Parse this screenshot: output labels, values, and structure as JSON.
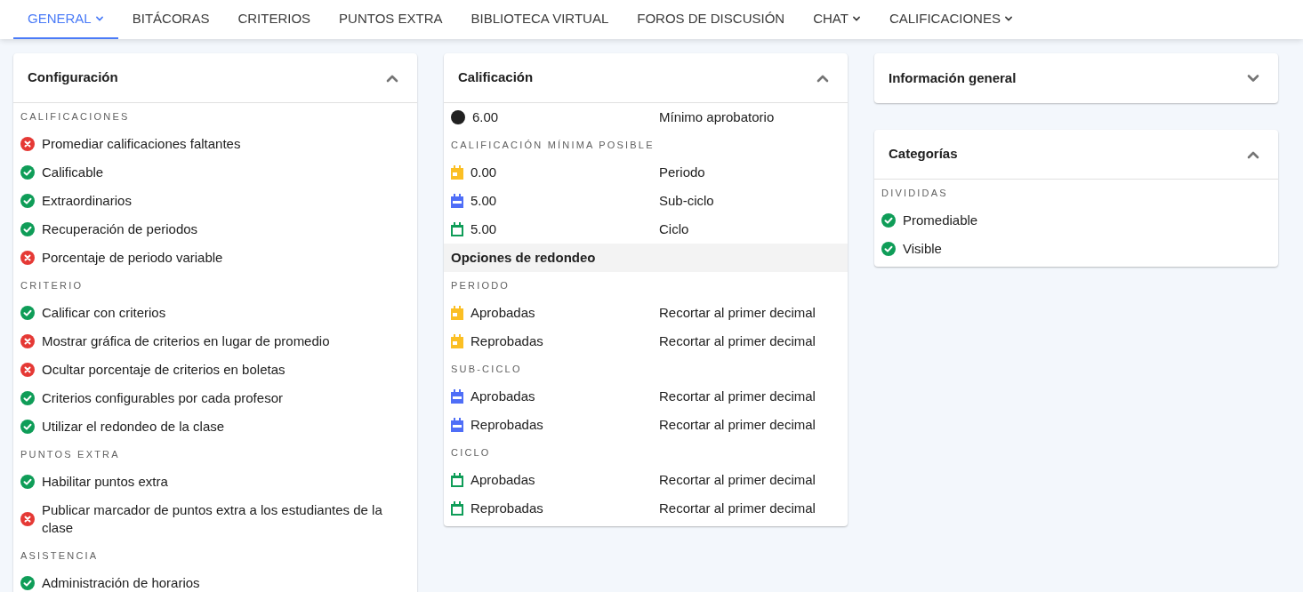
{
  "tabs": [
    {
      "label": "GENERAL",
      "selected": true,
      "dropdown": true
    },
    {
      "label": "BITÁCORAS",
      "selected": false,
      "dropdown": false
    },
    {
      "label": "CRITERIOS",
      "selected": false,
      "dropdown": false
    },
    {
      "label": "PUNTOS EXTRA",
      "selected": false,
      "dropdown": false
    },
    {
      "label": "BIBLIOTECA VIRTUAL",
      "selected": false,
      "dropdown": false
    },
    {
      "label": "FOROS DE DISCUSIÓN",
      "selected": false,
      "dropdown": false
    },
    {
      "label": "CHAT",
      "selected": false,
      "dropdown": true
    },
    {
      "label": "CALIFICACIONES",
      "selected": false,
      "dropdown": true
    }
  ],
  "columns": [
    [
      {
        "title": "Configuración",
        "expanded": true,
        "rows": [
          {
            "kind": "section",
            "label": "CALIFICACIONES"
          },
          {
            "kind": "flag",
            "label": "Promediar calificaciones faltantes",
            "enabled": false
          },
          {
            "kind": "flag",
            "label": "Calificable",
            "enabled": true
          },
          {
            "kind": "flag",
            "label": "Extraordinarios",
            "enabled": true
          },
          {
            "kind": "flag",
            "label": "Recuperación de periodos",
            "enabled": true
          },
          {
            "kind": "flag",
            "label": "Porcentaje de periodo variable",
            "enabled": false
          },
          {
            "kind": "section",
            "label": "CRITERIO"
          },
          {
            "kind": "flag",
            "label": "Calificar con criterios",
            "enabled": true
          },
          {
            "kind": "flag",
            "label": "Mostrar gráfica de criterios en lugar de promedio",
            "enabled": false
          },
          {
            "kind": "flag",
            "label": "Ocultar porcentaje de criterios en boletas",
            "enabled": false
          },
          {
            "kind": "flag",
            "label": "Criterios configurables por cada profesor",
            "enabled": true
          },
          {
            "kind": "flag",
            "label": "Utilizar el redondeo de la clase",
            "enabled": true
          },
          {
            "kind": "section",
            "label": "PUNTOS EXTRA"
          },
          {
            "kind": "flag",
            "label": "Habilitar puntos extra",
            "enabled": true
          },
          {
            "kind": "flag",
            "label": "Publicar marcador de puntos extra a los estudiantes de la clase",
            "enabled": false
          },
          {
            "kind": "section",
            "label": "ASISTENCIA"
          },
          {
            "kind": "flag",
            "label": "Administración de horarios",
            "enabled": true
          }
        ]
      }
    ],
    [
      {
        "title": "Calificación",
        "expanded": true,
        "rows": [
          {
            "kind": "minimum",
            "color": "#212121",
            "label": "6.00",
            "value": "Mínimo aprobatorio"
          },
          {
            "kind": "section",
            "label": "CALIFICACIÓN MÍNIMA POSIBLE"
          },
          {
            "kind": "period",
            "color": "#fbbf24",
            "label": "0.00",
            "value": "Periodo"
          },
          {
            "kind": "subcycle",
            "color": "#4f6ef7",
            "label": "5.00",
            "value": "Sub-ciclo"
          },
          {
            "kind": "cycle",
            "color": "#0f9d58",
            "label": "5.00",
            "value": "Ciclo"
          },
          {
            "kind": "group",
            "label": "Opciones de redondeo"
          },
          {
            "kind": "section",
            "label": "PERIODO"
          },
          {
            "kind": "period",
            "color": "#fbbf24",
            "label": "Aprobadas",
            "value": "Recortar al primer decimal"
          },
          {
            "kind": "period",
            "color": "#fbbf24",
            "label": "Reprobadas",
            "value": "Recortar al primer decimal"
          },
          {
            "kind": "section",
            "label": "SUB-CICLO"
          },
          {
            "kind": "subcycle",
            "color": "#4f6ef7",
            "label": "Aprobadas",
            "value": "Recortar al primer decimal"
          },
          {
            "kind": "subcycle",
            "color": "#4f6ef7",
            "label": "Reprobadas",
            "value": "Recortar al primer decimal"
          },
          {
            "kind": "section",
            "label": "CICLO"
          },
          {
            "kind": "cycle",
            "color": "#0f9d58",
            "label": "Aprobadas",
            "value": "Recortar al primer decimal"
          },
          {
            "kind": "cycle",
            "color": "#0f9d58",
            "label": "Reprobadas",
            "value": "Recortar al primer decimal"
          }
        ]
      }
    ],
    [
      {
        "title": "Información general",
        "expanded": false
      },
      {
        "title": "Categorías",
        "expanded": true,
        "rows": [
          {
            "kind": "section",
            "label": "DIVIDIDAS"
          },
          {
            "kind": "flag",
            "label": "Promediable",
            "enabled": true
          },
          {
            "kind": "flag",
            "label": "Visible",
            "enabled": true
          }
        ]
      }
    ]
  ]
}
